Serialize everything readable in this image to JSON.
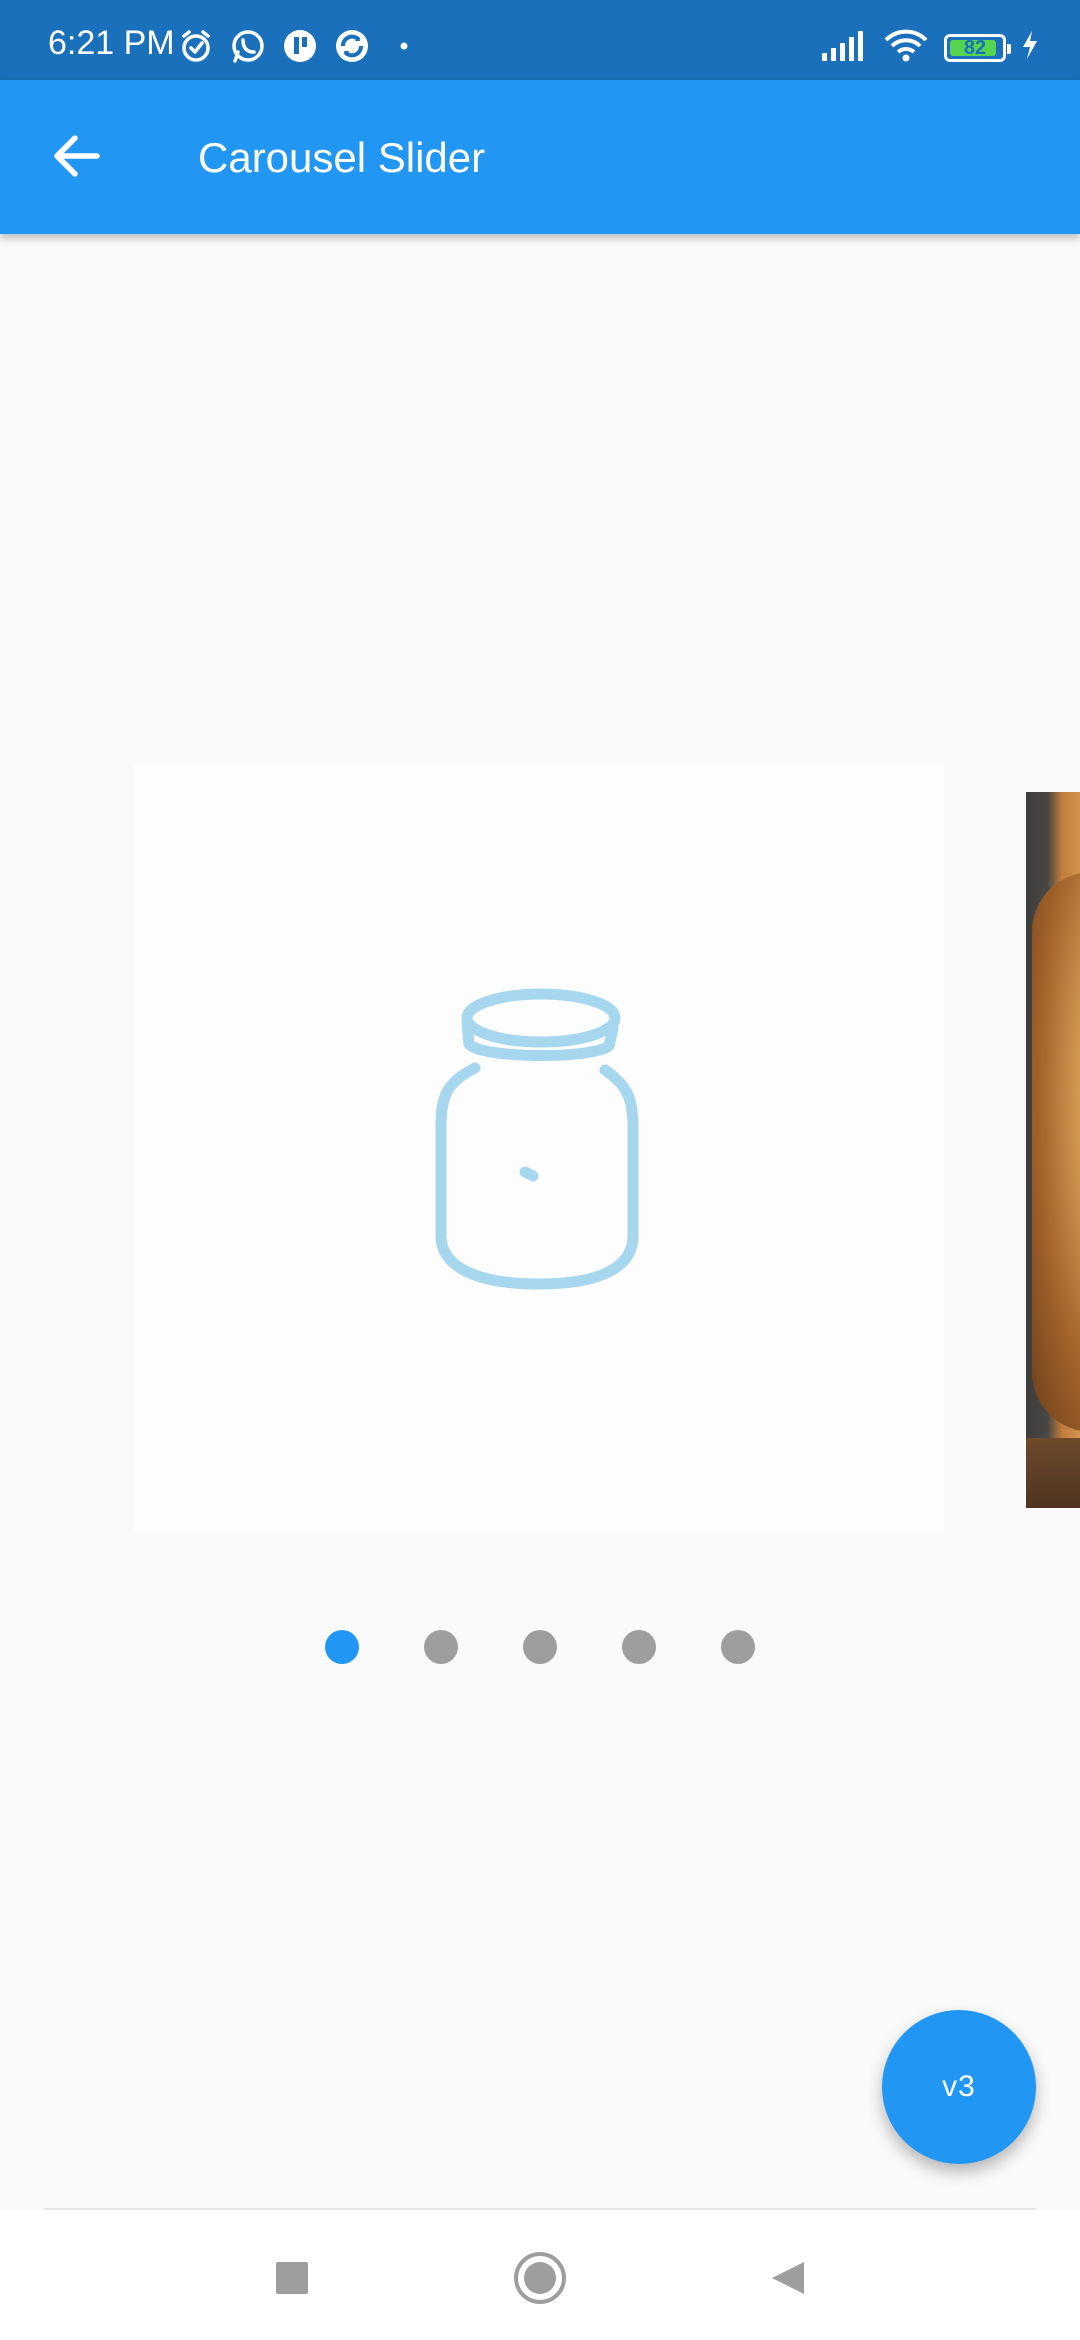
{
  "status_bar": {
    "time": "6:21 PM",
    "battery": "82",
    "icons_left": [
      "alarm-icon",
      "whatsapp-icon",
      "app-icon",
      "sync-icon",
      "dot-icon"
    ],
    "icons_right": [
      "signal-icon",
      "wifi-icon",
      "battery-icon",
      "charging-icon"
    ]
  },
  "app_bar": {
    "title": "Carousel Slider",
    "back_icon": "arrow-left-icon"
  },
  "carousel": {
    "current_index": 0,
    "slide_count": 5,
    "slides": [
      {
        "type": "placeholder",
        "icon": "jar-icon"
      },
      {
        "type": "image",
        "subject": "bread"
      }
    ],
    "indicator_active_color": "#2196F3",
    "indicator_inactive_color": "#9E9E9E"
  },
  "fab": {
    "label": "v3"
  },
  "nav_bar": {
    "buttons": [
      "recents-button",
      "home-button",
      "back-button"
    ]
  },
  "colors": {
    "primary": "#2196F3",
    "status_bar": "#1A70BB",
    "background": "#FAFAFA",
    "jar_icon": "#A7D6EF"
  }
}
